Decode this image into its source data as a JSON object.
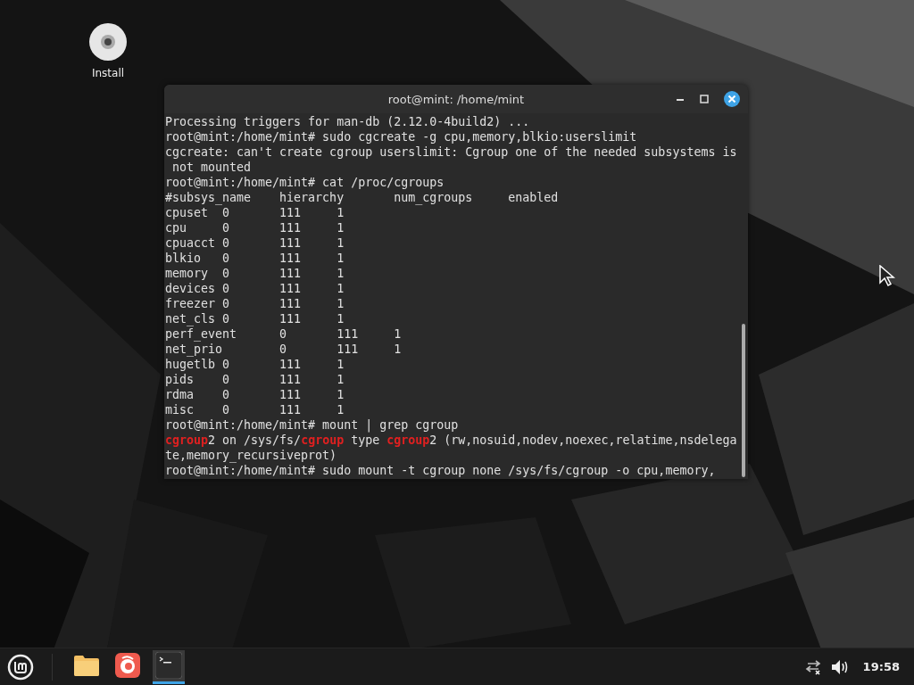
{
  "desktop_icons": [
    {
      "label": "Install"
    }
  ],
  "window": {
    "title": "root@mint: /home/mint",
    "active": true
  },
  "terminal": {
    "lines": [
      [
        {
          "text": "Processing triggers for man-db (2.12.0-4build2) ...",
          "highlight": false
        }
      ],
      [
        {
          "text": "root@mint:/home/mint# sudo cgcreate -g cpu,memory,blkio:userslimit",
          "highlight": false
        }
      ],
      [
        {
          "text": "cgcreate: can't create cgroup userslimit: Cgroup one of the needed subsystems is",
          "highlight": false
        }
      ],
      [
        {
          "text": " not mounted",
          "highlight": false
        }
      ],
      [
        {
          "text": "root@mint:/home/mint# cat /proc/cgroups",
          "highlight": false
        }
      ],
      [
        {
          "text": "#subsys_name    hierarchy       num_cgroups     enabled",
          "highlight": false
        }
      ],
      [
        {
          "text": "cpuset  0       111     1",
          "highlight": false
        }
      ],
      [
        {
          "text": "cpu     0       111     1",
          "highlight": false
        }
      ],
      [
        {
          "text": "cpuacct 0       111     1",
          "highlight": false
        }
      ],
      [
        {
          "text": "blkio   0       111     1",
          "highlight": false
        }
      ],
      [
        {
          "text": "memory  0       111     1",
          "highlight": false
        }
      ],
      [
        {
          "text": "devices 0       111     1",
          "highlight": false
        }
      ],
      [
        {
          "text": "freezer 0       111     1",
          "highlight": false
        }
      ],
      [
        {
          "text": "net_cls 0       111     1",
          "highlight": false
        }
      ],
      [
        {
          "text": "perf_event      0       111     1",
          "highlight": false
        }
      ],
      [
        {
          "text": "net_prio        0       111     1",
          "highlight": false
        }
      ],
      [
        {
          "text": "hugetlb 0       111     1",
          "highlight": false
        }
      ],
      [
        {
          "text": "pids    0       111     1",
          "highlight": false
        }
      ],
      [
        {
          "text": "rdma    0       111     1",
          "highlight": false
        }
      ],
      [
        {
          "text": "misc    0       111     1",
          "highlight": false
        }
      ],
      [
        {
          "text": "root@mint:/home/mint# mount | grep cgroup",
          "highlight": false
        }
      ],
      [
        {
          "text": "cgroup",
          "highlight": true
        },
        {
          "text": "2 on /sys/fs/",
          "highlight": false
        },
        {
          "text": "cgroup",
          "highlight": true
        },
        {
          "text": " type ",
          "highlight": false
        },
        {
          "text": "cgroup",
          "highlight": true
        },
        {
          "text": "2 (rw,nosuid,nodev,noexec,relatime,nsdelega",
          "highlight": false
        }
      ],
      [
        {
          "text": "te,memory_recursiveprot)",
          "highlight": false
        }
      ],
      [
        {
          "text": "root@mint:/home/mint# sudo mount -t cgroup none /sys/fs/cgroup -o cpu,memory,",
          "highlight": false
        }
      ]
    ]
  },
  "taskbar": {
    "apps": [
      {
        "kind": "files",
        "active": false
      },
      {
        "kind": "browser",
        "active": false
      },
      {
        "kind": "terminal",
        "active": true
      }
    ],
    "clock": "19:58"
  }
}
